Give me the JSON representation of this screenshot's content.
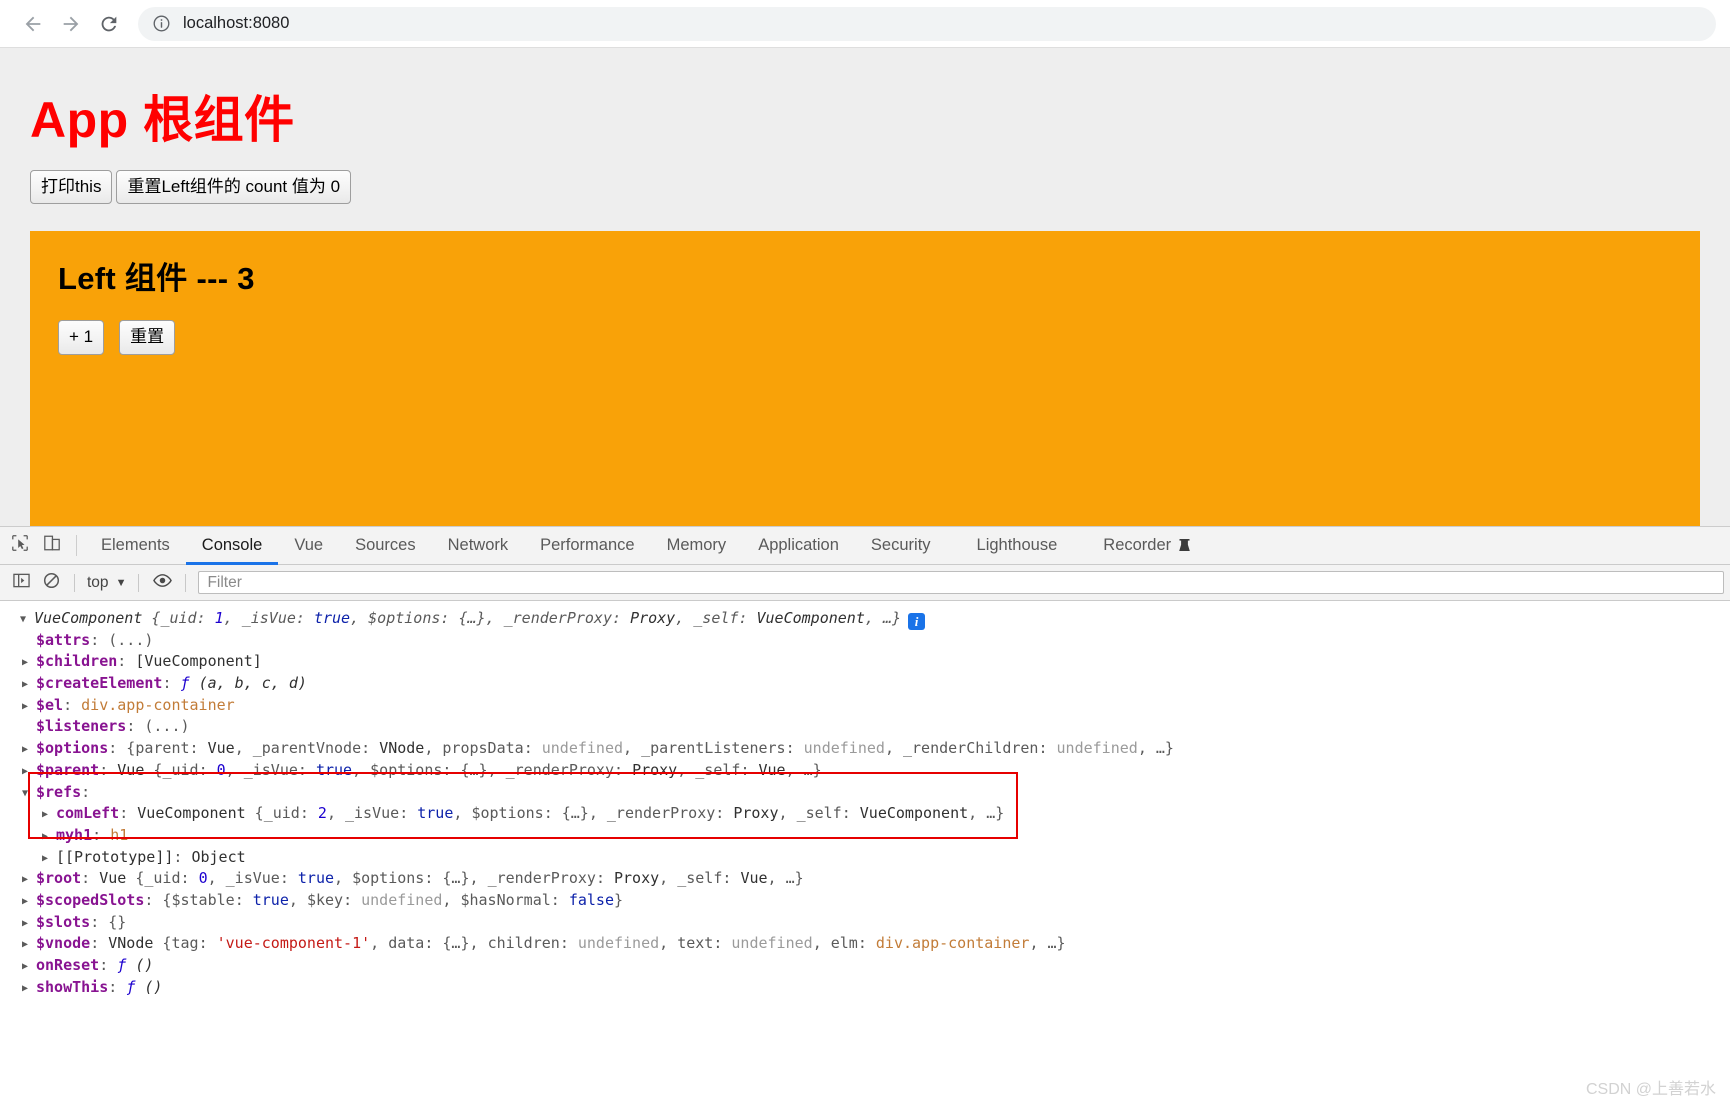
{
  "browser": {
    "back_label": "back-arrow",
    "forward_label": "forward-arrow",
    "reload_label": "reload",
    "site_info_label": "site-information",
    "url": "localhost:8080"
  },
  "page": {
    "app_title": "App 根组件",
    "app_title_color": "#ff0000",
    "buttons": [
      {
        "label": "打印this"
      },
      {
        "label": "重置Left组件的 count 值为 0"
      }
    ],
    "left_panel": {
      "bg_color": "#f9a208",
      "title": "Left 组件 --- 3",
      "buttons": [
        {
          "label": "+ 1"
        },
        {
          "label": "重置"
        }
      ]
    }
  },
  "devtools": {
    "tabs": [
      {
        "label": "Elements",
        "active": false
      },
      {
        "label": "Console",
        "active": true
      },
      {
        "label": "Vue",
        "active": false
      },
      {
        "label": "Sources",
        "active": false
      },
      {
        "label": "Network",
        "active": false
      },
      {
        "label": "Performance",
        "active": false
      },
      {
        "label": "Memory",
        "active": false
      },
      {
        "label": "Application",
        "active": false
      },
      {
        "label": "Security",
        "active": false
      },
      {
        "label": "Lighthouse",
        "active": false
      },
      {
        "label": "Recorder",
        "active": false
      }
    ],
    "active_tab_underline_color": "#1a73e8",
    "console_toolbar": {
      "context": "top",
      "context_caret": "▼",
      "filter_placeholder": "Filter"
    },
    "console": {
      "lines": {
        "l01_class": "VueComponent",
        "l01_uid_key": "_uid",
        "l01_uid_val": "1",
        "l01_isvue_key": "_isVue",
        "l01_isvue_val": "true",
        "l01_options_key": "$options",
        "l01_options_val": "{…}",
        "l01_rp_key": "_renderProxy",
        "l01_rp_val": "Proxy",
        "l01_self_key": "_self",
        "l01_self_val": "VueComponent",
        "l01_ellipsis": "…}",
        "l01_badge": "i",
        "l02_key": "$attrs",
        "l02_val": "(...)",
        "l03_key": "$children",
        "l03_val": "[VueComponent]",
        "l04_key": "$createElement",
        "l04_fn": "ƒ",
        "l04_args": "(a, b, c, d)",
        "l05_key": "$el",
        "l05_val": "div.app-container",
        "l06_key": "$listeners",
        "l06_val": "(...)",
        "l07_key": "$options",
        "l07_parent_k": "parent",
        "l07_parent_v": "Vue",
        "l07_pvnode_k": "_parentVnode",
        "l07_pvnode_v": "VNode",
        "l07_props_k": "propsData",
        "l07_props_v": "undefined",
        "l07_plisten_k": "_parentListeners",
        "l07_plisten_v": "undefined",
        "l07_rchild_k": "_renderChildren",
        "l07_rchild_v": "undefined",
        "l07_tail": "…}",
        "l08_key": "$parent",
        "l08_cls": "Vue",
        "l08_uid_k": "_uid",
        "l08_uid_v": "0",
        "l08_isvue_k": "_isVue",
        "l08_isvue_v": "true",
        "l08_opt_k": "$options",
        "l08_opt_v": "{…}",
        "l08_rp_k": "_renderProxy",
        "l08_rp_v": "Proxy",
        "l08_self_k": "_self",
        "l08_self_v": "Vue",
        "l08_tail": "…}",
        "l09_key": "$refs",
        "l10_key": "comLeft",
        "l10_cls": "VueComponent",
        "l10_uid_k": "_uid",
        "l10_uid_v": "2",
        "l10_isvue_k": "_isVue",
        "l10_isvue_v": "true",
        "l10_opt_k": "$options",
        "l10_opt_v": "{…}",
        "l10_rp_k": "_renderProxy",
        "l10_rp_v": "Proxy",
        "l10_self_k": "_self",
        "l10_self_v": "VueComponent",
        "l10_tail": "…}",
        "l11_key": "myh1",
        "l11_val": "h1",
        "l12_key": "[[Prototype]]",
        "l12_val": "Object",
        "l13_key": "$root",
        "l13_cls": "Vue",
        "l13_uid_k": "_uid",
        "l13_uid_v": "0",
        "l13_isvue_k": "_isVue",
        "l13_isvue_v": "true",
        "l13_opt_k": "$options",
        "l13_opt_v": "{…}",
        "l13_rp_k": "_renderProxy",
        "l13_rp_v": "Proxy",
        "l13_self_k": "_self",
        "l13_self_v": "Vue",
        "l13_tail": "…}",
        "l14_key": "$scopedSlots",
        "l14_stable_k": "$stable",
        "l14_stable_v": "true",
        "l14_key_k": "$key",
        "l14_key_v": "undefined",
        "l14_hasnorm_k": "$hasNormal",
        "l14_hasnorm_v": "false",
        "l15_key": "$slots",
        "l15_val": "{}",
        "l16_key": "$vnode",
        "l16_cls": "VNode",
        "l16_tag_k": "tag",
        "l16_tag_v": "'vue-component-1'",
        "l16_data_k": "data",
        "l16_data_v": "{…}",
        "l16_children_k": "children",
        "l16_children_v": "undefined",
        "l16_text_k": "text",
        "l16_text_v": "undefined",
        "l16_elm_k": "elm",
        "l16_elm_v": "div.app-container",
        "l16_tail": "…}",
        "l17_key": "onReset",
        "l17_fn": "ƒ",
        "l17_args": "()",
        "l18_key": "showThis",
        "l18_fn": "ƒ",
        "l18_args": "()"
      },
      "highlight_color": "#e60000"
    }
  },
  "watermark": "CSDN @上善若水"
}
